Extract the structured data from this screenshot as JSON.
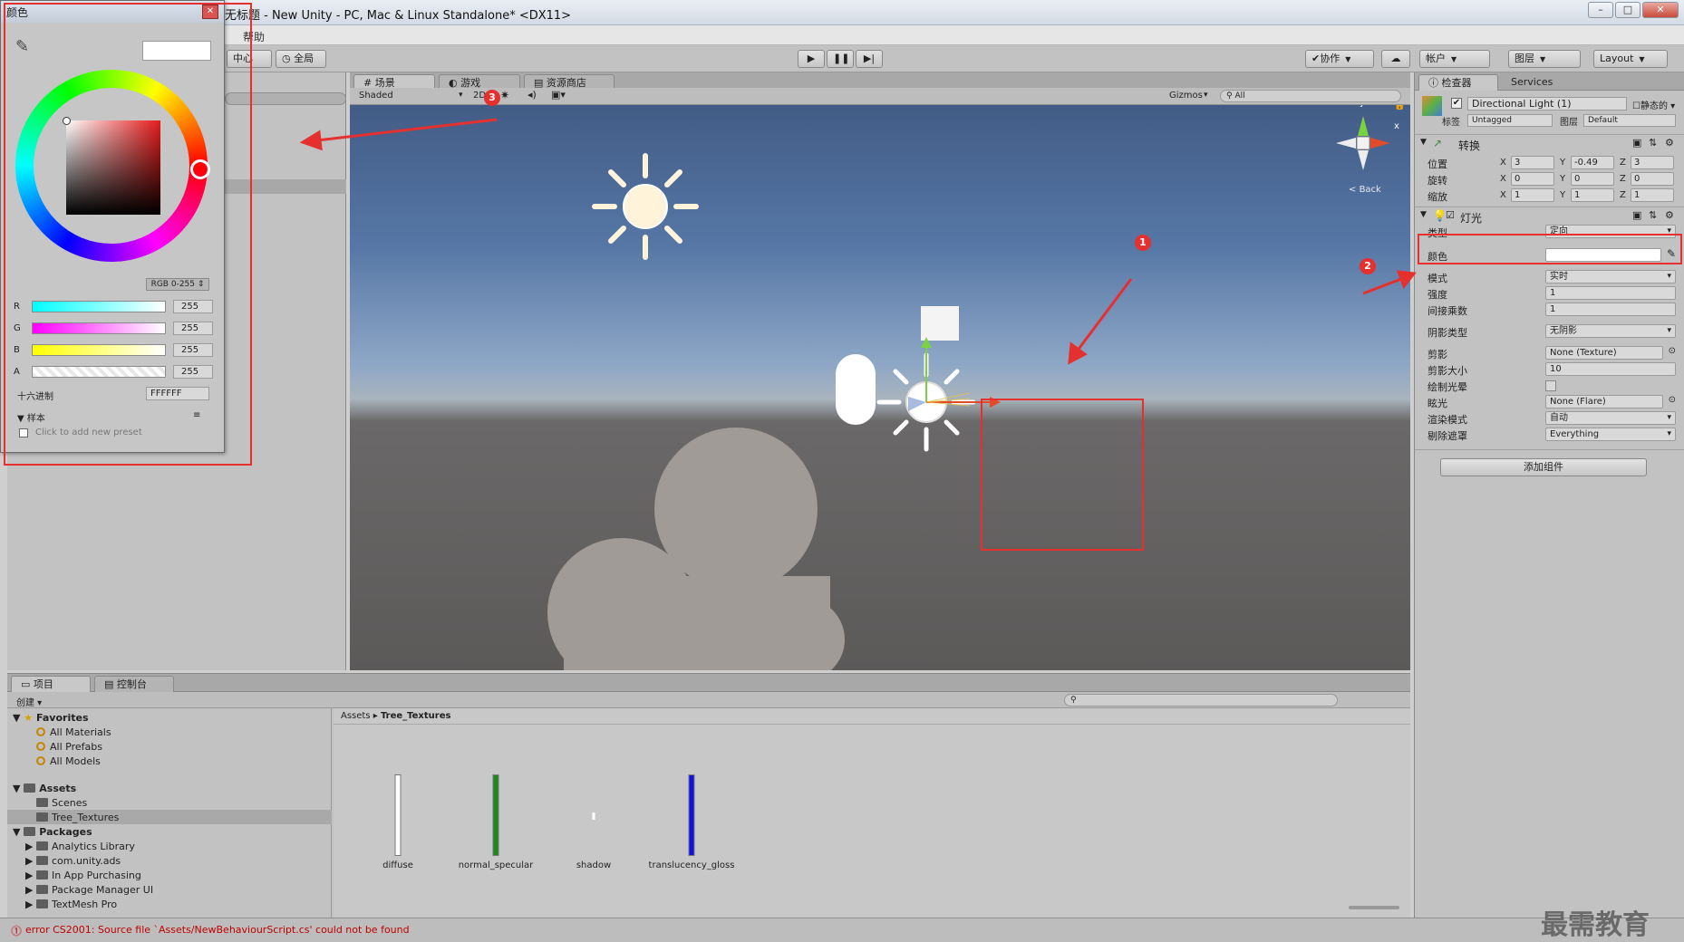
{
  "window": {
    "title": "无标题 - New Unity - PC, Mac & Linux Standalone* <DX11>",
    "menu": [
      "帮助"
    ]
  },
  "toolbar": {
    "pivot": "中心",
    "global": "全局",
    "collab": "协作",
    "account": "帐户",
    "layers": "图层",
    "layout": "Layout"
  },
  "scene": {
    "tabs": [
      "场景",
      "游戏",
      "资源商店"
    ],
    "shading": "Shaded",
    "mode_2d": "2D",
    "gizmos": "Gizmos",
    "search": "All",
    "gizmo_axes": {
      "y": "y",
      "x": "x",
      "back": "Back"
    }
  },
  "inspector": {
    "tabs": [
      "检查器",
      "Services"
    ],
    "object_name": "Directional Light (1)",
    "static_label": "静态的",
    "tag_label": "标签",
    "tag_value": "Untagged",
    "layer_label": "图层",
    "layer_value": "Default",
    "transform": {
      "title": "转换",
      "rows": [
        {
          "label": "位置",
          "x": "3",
          "y": "-0.49",
          "z": "3"
        },
        {
          "label": "旋转",
          "x": "0",
          "y": "0",
          "z": "0"
        },
        {
          "label": "缩放",
          "x": "1",
          "y": "1",
          "z": "1"
        }
      ]
    },
    "light": {
      "title": "灯光",
      "rows": [
        {
          "label": "类型",
          "value": "定向"
        },
        {
          "label": "颜色",
          "value": ""
        },
        {
          "label": "模式",
          "value": "实时"
        },
        {
          "label": "强度",
          "value": "1"
        },
        {
          "label": "间接乘数",
          "value": "1"
        },
        {
          "label": "阴影类型",
          "value": "无阴影"
        },
        {
          "label": "剪影",
          "value": "None (Texture)"
        },
        {
          "label": "剪影大小",
          "value": "10"
        },
        {
          "label": "绘制光晕",
          "value": ""
        },
        {
          "label": "眩光",
          "value": "None (Flare)"
        },
        {
          "label": "渲染模式",
          "value": "自动"
        },
        {
          "label": "剔除遮罩",
          "value": "Everything"
        }
      ]
    },
    "add_component": "添加组件"
  },
  "project": {
    "tabs": [
      "项目",
      "控制台"
    ],
    "create": "创建",
    "favorites_label": "Favorites",
    "favorites": [
      "All Materials",
      "All Prefabs",
      "All Models"
    ],
    "assets_label": "Assets",
    "asset_folders": [
      "Scenes",
      "Tree_Textures"
    ],
    "packages_label": "Packages",
    "packages": [
      "Analytics Library",
      "com.unity.ads",
      "In App Purchasing",
      "Package Manager UI",
      "TextMesh Pro"
    ],
    "breadcrumb": [
      "Assets",
      "Tree_Textures"
    ],
    "items": [
      {
        "name": "diffuse",
        "color": "#ffffff"
      },
      {
        "name": "normal_specular",
        "color": "#1a8a1a"
      },
      {
        "name": "shadow",
        "color": "#ffffff"
      },
      {
        "name": "translucency_gloss",
        "color": "#1010e0"
      }
    ]
  },
  "status": {
    "error": "error CS2001: Source file `Assets/NewBehaviourScript.cs' could not be found"
  },
  "picker": {
    "title": "颜色",
    "mode": "RGB 0-255",
    "channels": [
      {
        "label": "R",
        "value": "255"
      },
      {
        "label": "G",
        "value": "255"
      },
      {
        "label": "B",
        "value": "255"
      },
      {
        "label": "A",
        "value": "255"
      }
    ],
    "hex_label": "十六进制",
    "hex_value": "FFFFFF",
    "swatches_label": "样本",
    "add_preset": "Click to add new preset"
  },
  "annotations": [
    "1",
    "2",
    "3"
  ],
  "watermark": "最需教育",
  "colors": {
    "annotation": "#e53030",
    "sky_top": "#425c86",
    "ground": "#5c5a59"
  }
}
